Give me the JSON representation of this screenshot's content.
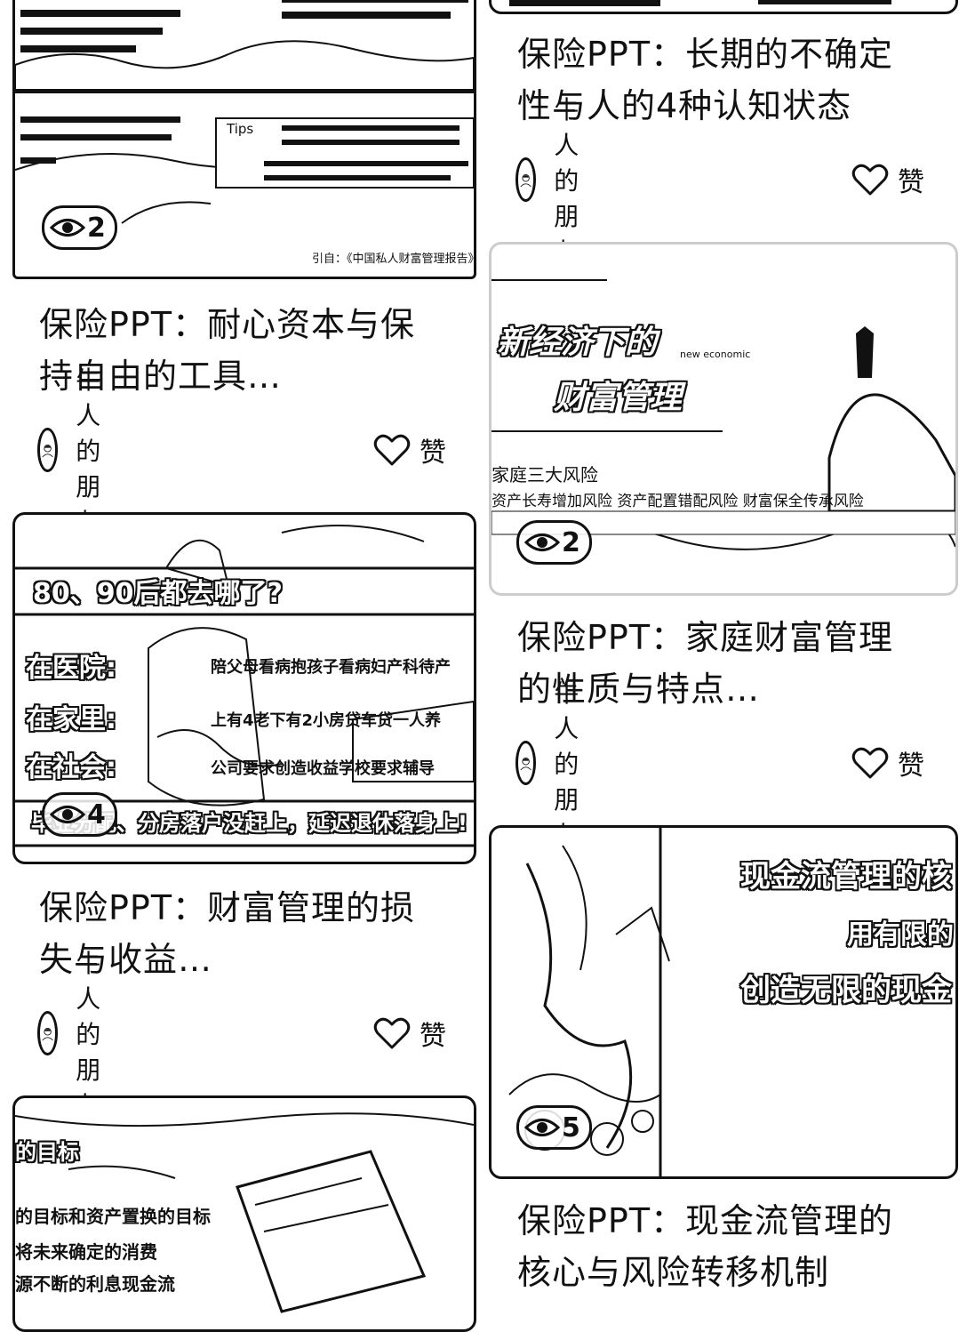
{
  "cards": [
    {
      "thumb_text": [
        "Tips",
        "引自：《中国私人财富管理报告》"
      ],
      "views": "2",
      "title_lines": [
        "保险PPT：耐心资本与保",
        "持自由的工具…"
      ],
      "author": "牛人的朋友",
      "like_label": "赞"
    },
    {
      "thumb_text": [
        "80、90后都去哪了?",
        "在医院:",
        "陪父母看病抱孩子看病妇产科待产",
        "在家里:",
        "上有4老下有2小房贷车贷一人养",
        "在社会:",
        "公司要求创造收益学校要求辅导",
        "毕业分配、分房落户没赶上，延迟退休落身上!"
      ],
      "views": "4",
      "title_lines": [
        "保险PPT：财富管理的损",
        "失与收益…"
      ],
      "author": "牛人的朋友",
      "like_label": "赞"
    },
    {
      "thumb_text": [
        "的目标",
        "的目标和资产置换的目标",
        "将未来确定的消费",
        "源不断的利息现金流"
      ],
      "title_lines": [],
      "author": "",
      "like_label": ""
    },
    {
      "thumb_text": [],
      "title_lines": [
        "保险PPT：长期的不确定",
        "性与人的4种认知状态"
      ],
      "author": "牛人的朋友",
      "like_label": "赞"
    },
    {
      "thumb_text": [
        "新经济下的",
        "财富管理",
        "new economic",
        "家庭三大风险",
        "资产长寿增加风险 资产配置错配风险 财富保全传承风险"
      ],
      "views": "2",
      "title_lines": [
        "保险PPT：家庭财富管理",
        "的性质与特点…"
      ],
      "author": "牛人的朋友",
      "like_label": "赞"
    },
    {
      "thumb_text": [
        "现金流管理的核",
        "用有限的",
        "创造无限的现金"
      ],
      "views": "5",
      "title_lines": [
        "保险PPT：现金流管理的",
        "核心与风险转移机制"
      ],
      "author": "",
      "like_label": ""
    }
  ]
}
